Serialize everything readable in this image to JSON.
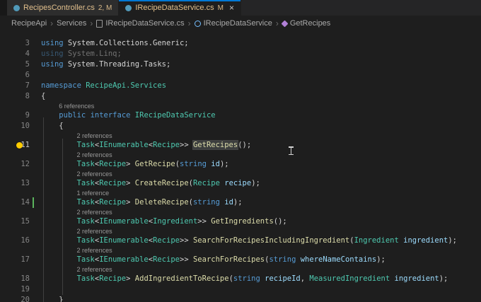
{
  "tabs": [
    {
      "label": "RecipesController.cs",
      "badge": "2, M",
      "active": false
    },
    {
      "label": "IRecipeDataService.cs",
      "badge": "M",
      "active": true
    }
  ],
  "icons": {
    "close": "×",
    "chevron": "›"
  },
  "breadcrumb": {
    "items": [
      "RecipeApi",
      "Services",
      "IRecipeDataService.cs",
      "IRecipeDataService",
      "GetRecipes"
    ]
  },
  "colors": {
    "editor_bg": "#1e1e1e",
    "tabbar_bg": "#252526",
    "tab_inactive_bg": "#2d2d2d",
    "tab_modified_text": "#e2c08d",
    "active_tab_border": "#0078d4",
    "keyword": "#569cd6",
    "type": "#4ec9b0",
    "method": "#dcdcaa",
    "variable": "#9cdcfe",
    "plain": "#d4d4d4",
    "line_number": "#858585",
    "line_number_active": "#c6c6c6",
    "codelens": "#999999",
    "lightbulb": "#ffcc00",
    "gutter_added": "#5bb55d",
    "indent_guide": "#404040",
    "breadcrumb_text": "#a9a9a9",
    "interface_icon": "#75beff",
    "method_icon": "#b180d7",
    "file_icon": "#519aba"
  },
  "editor": {
    "rows": [
      {
        "n": 3,
        "tokens": [
          [
            "using",
            "kw"
          ],
          [
            " System.Collections.Generic;",
            "pl"
          ]
        ]
      },
      {
        "n": 4,
        "dim": true,
        "tokens": [
          [
            "using",
            "kw"
          ],
          [
            " System.Linq;",
            "pl"
          ]
        ]
      },
      {
        "n": 5,
        "tokens": [
          [
            "using",
            "kw"
          ],
          [
            " System.Threading.Tasks;",
            "pl"
          ]
        ]
      },
      {
        "n": 6,
        "tokens": []
      },
      {
        "n": 7,
        "tokens": [
          [
            "namespace",
            "kw"
          ],
          [
            " ",
            "pl"
          ],
          [
            "RecipeApi.Services",
            "type"
          ]
        ]
      },
      {
        "n": 8,
        "tokens": [
          [
            "{",
            "pl"
          ]
        ]
      },
      {
        "lens": "6 references",
        "indent": 4
      },
      {
        "n": 9,
        "tokens": [
          [
            "    ",
            "pl"
          ],
          [
            "public",
            "kw"
          ],
          [
            " ",
            "pl"
          ],
          [
            "interface",
            "kw"
          ],
          [
            " ",
            "pl"
          ],
          [
            "IRecipeDataService",
            "type"
          ]
        ]
      },
      {
        "n": 10,
        "tokens": [
          [
            "    {",
            "pl"
          ]
        ]
      },
      {
        "lens": "2 references",
        "indent": 8
      },
      {
        "n": 11,
        "bulb": true,
        "active": true,
        "tokens": [
          [
            "        ",
            "pl"
          ],
          [
            "Task",
            "type"
          ],
          [
            "<",
            "pl"
          ],
          [
            "IEnumerable",
            "type"
          ],
          [
            "<",
            "pl"
          ],
          [
            "Recipe",
            "type"
          ],
          [
            ">> ",
            "pl"
          ],
          [
            "GetRecipes",
            "fn",
            "hl"
          ],
          [
            "();",
            "pl"
          ]
        ]
      },
      {
        "lens": "2 references",
        "indent": 8
      },
      {
        "n": 12,
        "tokens": [
          [
            "        ",
            "pl"
          ],
          [
            "Task",
            "type"
          ],
          [
            "<",
            "pl"
          ],
          [
            "Recipe",
            "type"
          ],
          [
            "> ",
            "pl"
          ],
          [
            "GetRecipe",
            "fn"
          ],
          [
            "(",
            "pl"
          ],
          [
            "string",
            "kw"
          ],
          [
            " ",
            "pl"
          ],
          [
            "id",
            "var"
          ],
          [
            ");",
            "pl"
          ]
        ]
      },
      {
        "lens": "2 references",
        "indent": 8
      },
      {
        "n": 13,
        "tokens": [
          [
            "        ",
            "pl"
          ],
          [
            "Task",
            "type"
          ],
          [
            "<",
            "pl"
          ],
          [
            "Recipe",
            "type"
          ],
          [
            "> ",
            "pl"
          ],
          [
            "CreateRecipe",
            "fn"
          ],
          [
            "(",
            "pl"
          ],
          [
            "Recipe",
            "type"
          ],
          [
            " ",
            "pl"
          ],
          [
            "recipe",
            "var"
          ],
          [
            ");",
            "pl"
          ]
        ]
      },
      {
        "lens": "1 reference",
        "indent": 8
      },
      {
        "n": 14,
        "mod": true,
        "tokens": [
          [
            "        ",
            "pl"
          ],
          [
            "Task",
            "type"
          ],
          [
            "<",
            "pl"
          ],
          [
            "Recipe",
            "type"
          ],
          [
            "> ",
            "pl"
          ],
          [
            "DeleteRecipe",
            "fn"
          ],
          [
            "(",
            "pl"
          ],
          [
            "string",
            "kw"
          ],
          [
            " ",
            "pl"
          ],
          [
            "id",
            "var"
          ],
          [
            ");",
            "pl"
          ]
        ]
      },
      {
        "lens": "2 references",
        "indent": 8
      },
      {
        "n": 15,
        "tokens": [
          [
            "        ",
            "pl"
          ],
          [
            "Task",
            "type"
          ],
          [
            "<",
            "pl"
          ],
          [
            "IEnumerable",
            "type"
          ],
          [
            "<",
            "pl"
          ],
          [
            "Ingredient",
            "type"
          ],
          [
            ">> ",
            "pl"
          ],
          [
            "GetIngredients",
            "fn"
          ],
          [
            "();",
            "pl"
          ]
        ]
      },
      {
        "lens": "2 references",
        "indent": 8
      },
      {
        "n": 16,
        "tokens": [
          [
            "        ",
            "pl"
          ],
          [
            "Task",
            "type"
          ],
          [
            "<",
            "pl"
          ],
          [
            "IEnumerable",
            "type"
          ],
          [
            "<",
            "pl"
          ],
          [
            "Recipe",
            "type"
          ],
          [
            ">> ",
            "pl"
          ],
          [
            "SearchForRecipesIncludingIngredient",
            "fn"
          ],
          [
            "(",
            "pl"
          ],
          [
            "Ingredient",
            "type"
          ],
          [
            " ",
            "pl"
          ],
          [
            "ingredient",
            "var"
          ],
          [
            ");",
            "pl"
          ]
        ]
      },
      {
        "lens": "2 references",
        "indent": 8
      },
      {
        "n": 17,
        "tokens": [
          [
            "        ",
            "pl"
          ],
          [
            "Task",
            "type"
          ],
          [
            "<",
            "pl"
          ],
          [
            "IEnumerable",
            "type"
          ],
          [
            "<",
            "pl"
          ],
          [
            "Recipe",
            "type"
          ],
          [
            ">> ",
            "pl"
          ],
          [
            "SearchForRecipes",
            "fn"
          ],
          [
            "(",
            "pl"
          ],
          [
            "string",
            "kw"
          ],
          [
            " ",
            "pl"
          ],
          [
            "whereNameContains",
            "var"
          ],
          [
            ");",
            "pl"
          ]
        ]
      },
      {
        "lens": "2 references",
        "indent": 8
      },
      {
        "n": 18,
        "tokens": [
          [
            "        ",
            "pl"
          ],
          [
            "Task",
            "type"
          ],
          [
            "<",
            "pl"
          ],
          [
            "Recipe",
            "type"
          ],
          [
            "> ",
            "pl"
          ],
          [
            "AddIngredientToRecipe",
            "fn"
          ],
          [
            "(",
            "pl"
          ],
          [
            "string",
            "kw"
          ],
          [
            " ",
            "pl"
          ],
          [
            "recipeId",
            "var"
          ],
          [
            ", ",
            "pl"
          ],
          [
            "MeasuredIngredient",
            "type"
          ],
          [
            " ",
            "pl"
          ],
          [
            "ingredient",
            "var"
          ],
          [
            ");",
            "pl"
          ]
        ]
      },
      {
        "n": 19,
        "tokens": []
      },
      {
        "n": 20,
        "tokens": [
          [
            "    }",
            "pl"
          ]
        ]
      }
    ]
  }
}
